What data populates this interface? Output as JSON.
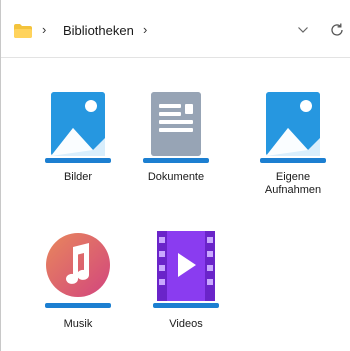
{
  "breadcrumb": {
    "folder_icon": "folder-icon",
    "separator": "›",
    "location": "Bibliotheken",
    "trailing_separator": "›"
  },
  "controls": {
    "dropdown_icon": "chevron-down-icon",
    "refresh_icon": "refresh-icon"
  },
  "libraries": [
    {
      "label": "Bilder",
      "icon": "pictures-library-icon"
    },
    {
      "label": "Dokumente",
      "icon": "documents-library-icon"
    },
    {
      "label_line1": "Eigene",
      "label_line2": "Aufnahmen",
      "icon": "camera-roll-library-icon"
    },
    {
      "label": "Musik",
      "icon": "music-library-icon"
    },
    {
      "label": "Videos",
      "icon": "videos-library-icon"
    }
  ],
  "colors": {
    "accent_blue": "#1e8fd8",
    "doc_gray": "#8a98ab",
    "music_pink": "#e0577f",
    "video_purple": "#8a3cf0"
  }
}
